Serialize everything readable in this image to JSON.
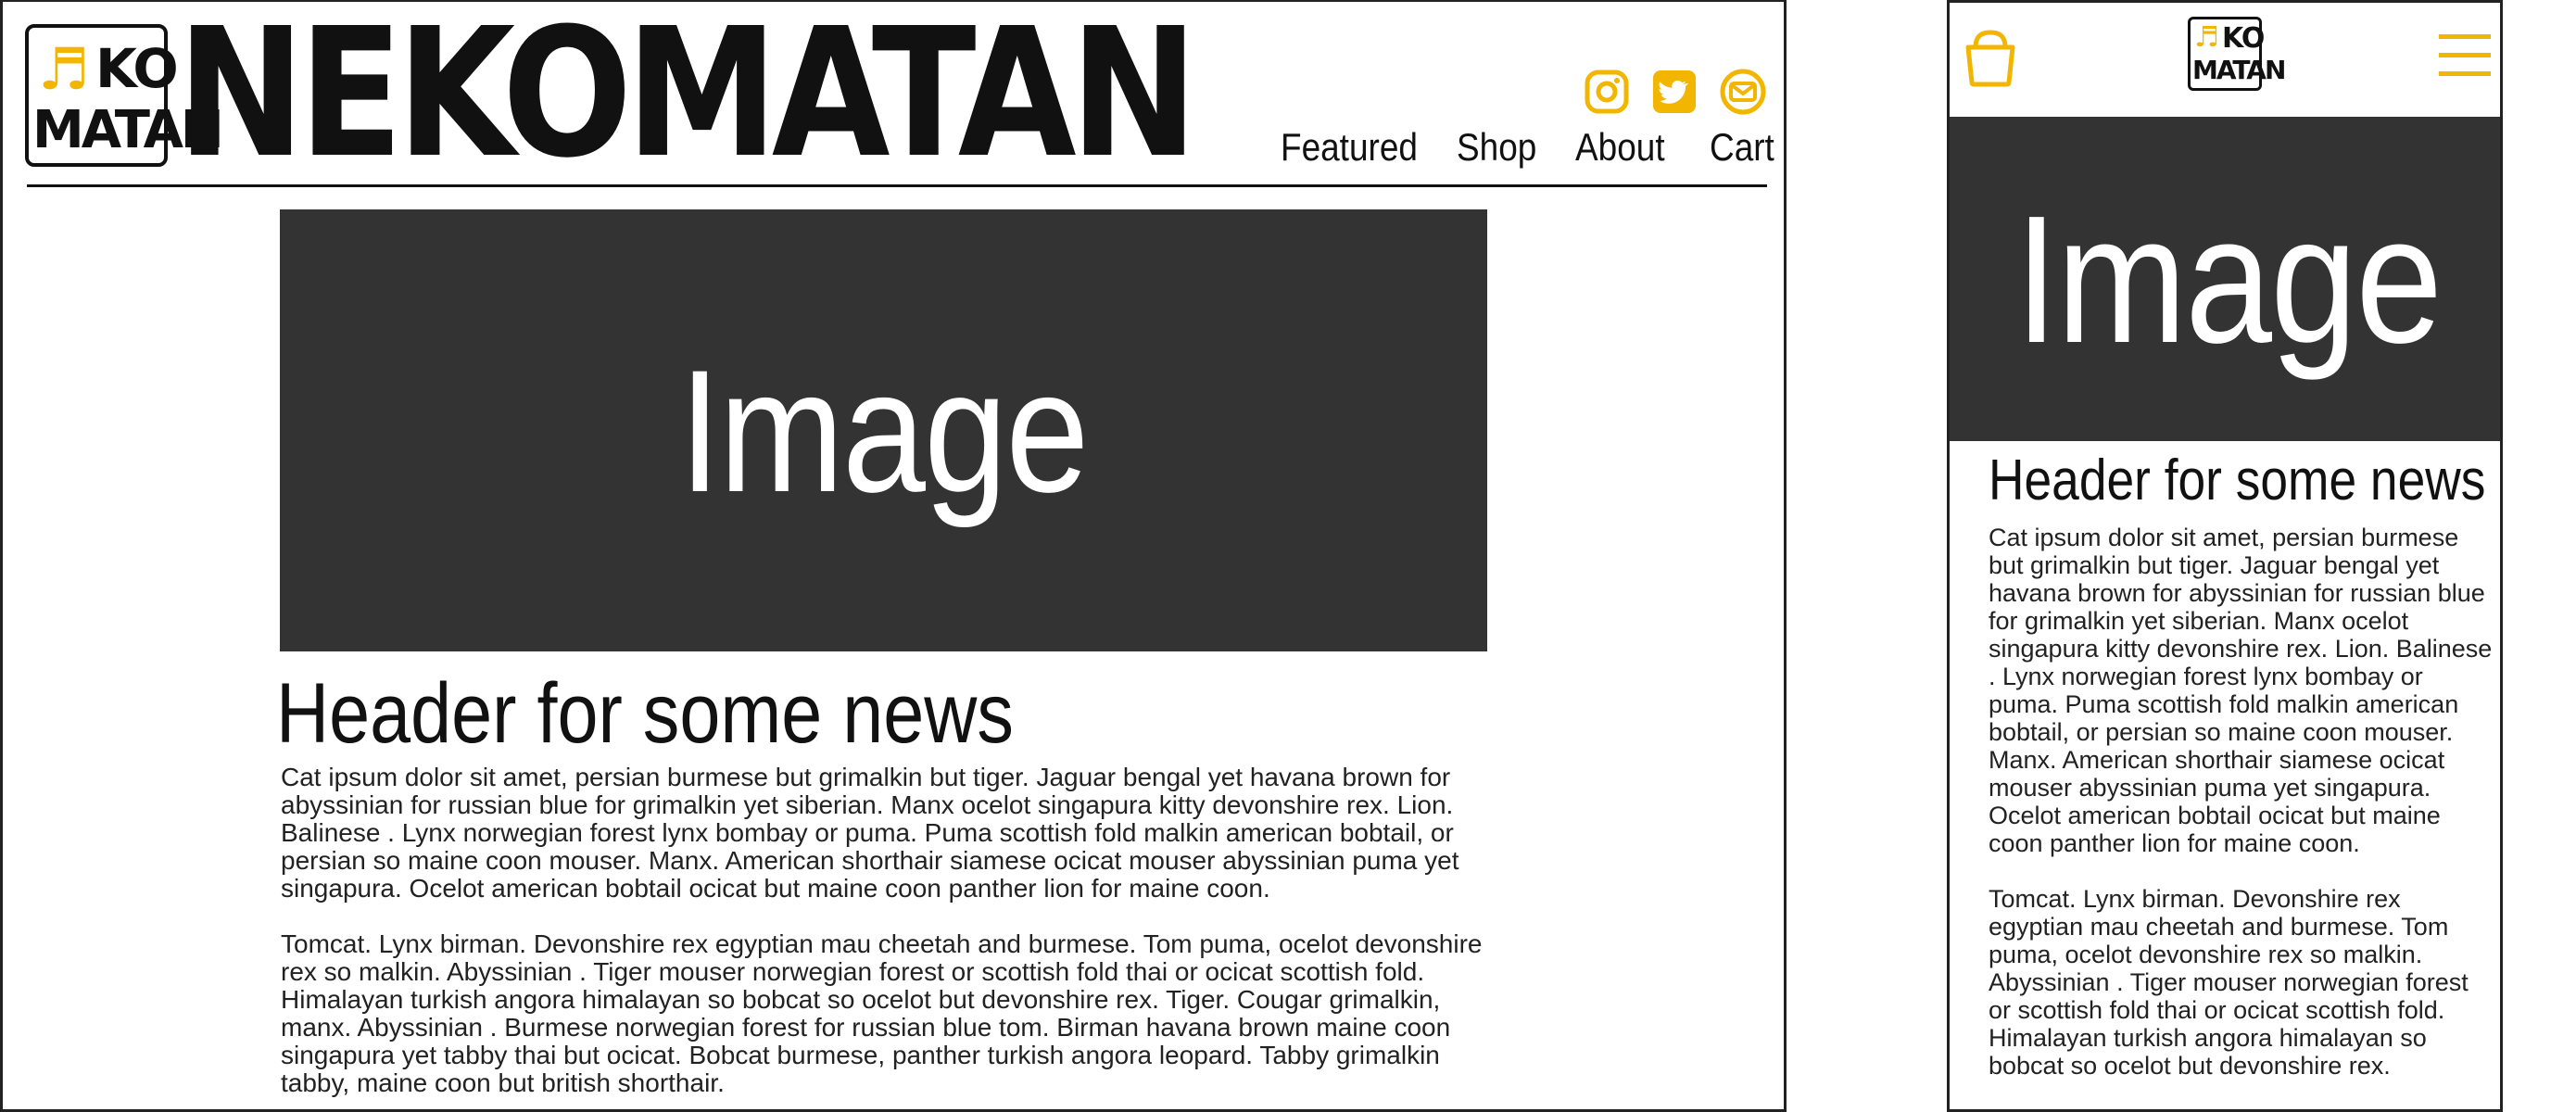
{
  "desktop": {
    "logo": {
      "glyph": "♬",
      "ko": "KO",
      "matan": "MATAN"
    },
    "brand": "NEKOMATAN",
    "social": [
      {
        "icon": "instagram-icon"
      },
      {
        "icon": "twitter-icon"
      },
      {
        "icon": "mail-icon"
      }
    ],
    "nav": [
      "Featured",
      "Shop",
      "About",
      "Cart"
    ],
    "hero_label": "Image",
    "headline": "Header for some news",
    "paragraphs": [
      "Cat ipsum dolor sit amet, persian burmese but grimalkin but tiger. Jaguar bengal yet havana brown for abyssinian for russian blue for grimalkin yet siberian. Manx ocelot singapura kitty devonshire rex. Lion. Balinese . Lynx norwegian forest lynx bombay or puma. Puma scottish fold malkin american bobtail, or persian so maine coon mouser. Manx. American shorthair siamese ocicat mouser abyssinian puma yet singapura. Ocelot american bobtail ocicat but maine coon panther lion for maine coon.",
      "Tomcat. Lynx birman. Devonshire rex egyptian mau cheetah and burmese. Tom puma, ocelot devonshire rex so malkin. Abyssinian . Tiger mouser norwegian forest or scottish fold thai or ocicat scottish fold. Himalayan turkish angora himalayan so bobcat so ocelot but devonshire rex. Tiger. Cougar grimalkin, manx. Abyssinian . Burmese norwegian forest for russian blue tom. Birman havana brown maine coon singapura yet tabby thai but ocicat. Bobcat burmese, panther turkish angora leopard. Tabby grimalkin tabby, maine coon but british shorthair."
    ]
  },
  "mobile": {
    "logo": {
      "glyph": "♬",
      "ko": "KO",
      "matan": "MATAN"
    },
    "hero_label": "Image",
    "headline": "Header for some news",
    "paragraphs": [
      "Cat ipsum dolor sit amet, persian burmese but grimalkin but tiger. Jaguar bengal yet havana brown for abyssinian for russian blue for grimalkin yet siberian. Manx ocelot singapura kitty devonshire rex. Lion. Balinese . Lynx norwegian forest lynx bombay or puma. Puma scottish fold malkin american bobtail, or persian so maine coon mouser. Manx. American shorthair siamese ocicat mouser abyssinian puma yet singapura. Ocelot american bobtail ocicat but maine coon panther lion for maine coon.",
      "Tomcat. Lynx birman. Devonshire rex egyptian mau cheetah and burmese. Tom puma, ocelot devonshire rex so malkin. Abyssinian . Tiger mouser norwegian forest or scottish fold thai or ocicat scottish fold. Himalayan turkish angora himalayan so bobcat so ocelot but devonshire rex."
    ]
  },
  "colors": {
    "accent": "#f2b500",
    "hero": "#333333",
    "text": "#111111"
  }
}
